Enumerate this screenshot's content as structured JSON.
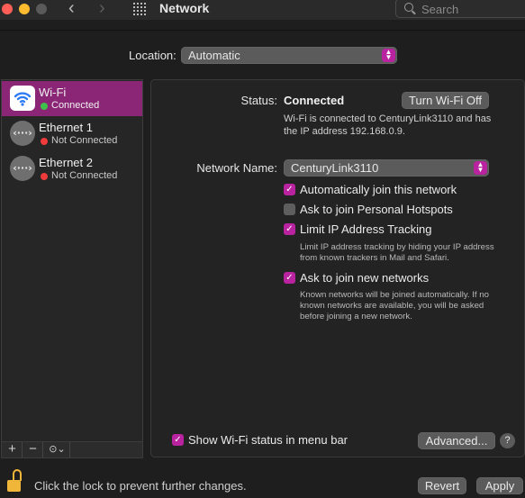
{
  "window": {
    "title": "Network",
    "search_placeholder": "Search"
  },
  "location": {
    "label": "Location:",
    "value": "Automatic"
  },
  "sidebar": {
    "services": [
      {
        "name": "Wi-Fi",
        "status": "Connected",
        "status_color": "#3fc04b",
        "icon": "wifi-icon",
        "selected": true
      },
      {
        "name": "Ethernet 1",
        "status": "Not Connected",
        "status_color": "#ef3b3b",
        "icon": "ethernet-icon",
        "selected": false
      },
      {
        "name": "Ethernet 2",
        "status": "Not Connected",
        "status_color": "#ef3b3b",
        "icon": "ethernet-icon",
        "selected": false
      }
    ],
    "tools": {
      "add": "+",
      "remove": "−",
      "action": "⊙⌄"
    }
  },
  "detail": {
    "status_label": "Status:",
    "status_value": "Connected",
    "toggle_wifi_label": "Turn Wi-Fi Off",
    "status_description": "Wi-Fi is connected to CenturyLink3110 and has the IP address 192.168.0.9.",
    "network_name_label": "Network Name:",
    "network_name_value": "CenturyLink3110",
    "options": [
      {
        "label": "Automatically join this network",
        "checked": true
      },
      {
        "label": "Ask to join Personal Hotspots",
        "checked": false
      },
      {
        "label": "Limit IP Address Tracking",
        "checked": true,
        "help": "Limit IP address tracking by hiding your IP address from known trackers in Mail and Safari."
      },
      {
        "label": "Ask to join new networks",
        "checked": true,
        "help": "Known networks will be joined automatically. If no known networks are available, you will be asked before joining a new network."
      }
    ],
    "show_status_label": "Show Wi-Fi status in menu bar",
    "show_status_checked": true,
    "advanced_label": "Advanced...",
    "help_label": "?"
  },
  "footer": {
    "lock_text": "Click the lock to prevent further changes.",
    "revert_label": "Revert",
    "apply_label": "Apply"
  },
  "colors": {
    "accent": "#b9239f",
    "selection": "#8a2675",
    "lock": "#f0b63a"
  }
}
